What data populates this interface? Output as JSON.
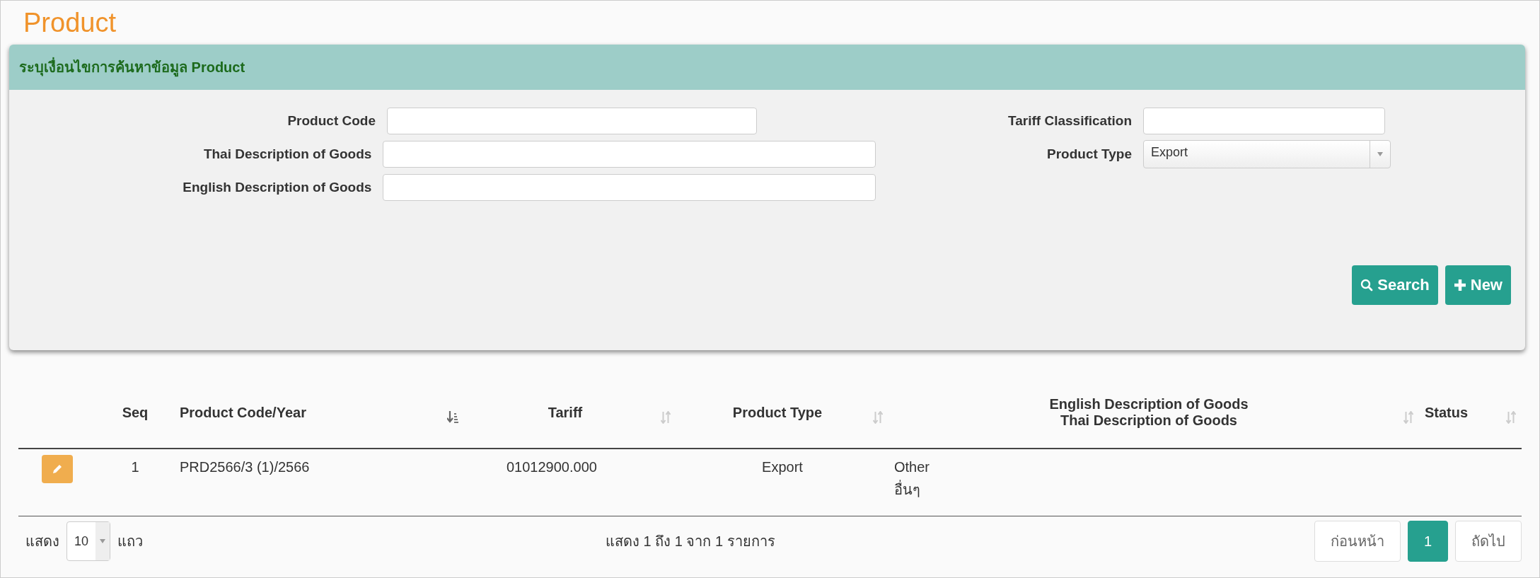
{
  "page_title": "Product",
  "search_panel": {
    "title": "ระบุเงื่อนไขการค้นหาข้อมูล Product",
    "left_fields": [
      {
        "label": "Product Code",
        "kind": "short"
      },
      {
        "label": "Thai Description of Goods",
        "kind": "long"
      },
      {
        "label": "English Description of Goods",
        "kind": "long"
      }
    ],
    "right_fields": [
      {
        "label": "Tariff Classification",
        "kind": "text"
      },
      {
        "label": "Product Type",
        "kind": "select",
        "value": "Export"
      }
    ],
    "buttons": [
      {
        "label": "Search",
        "kind": "search"
      },
      {
        "label": "New",
        "kind": "new"
      }
    ]
  },
  "table": {
    "columns": [
      {
        "label": "Seq",
        "kind": "plain"
      },
      {
        "label": "Product Code/Year",
        "kind": "sortable",
        "sorted": true
      },
      {
        "label": "Tariff",
        "kind": "sortable",
        "sorted": false
      },
      {
        "label": "Product Type",
        "kind": "sortable",
        "sorted": false
      },
      {
        "label": "English Description of Goods",
        "label_2": "Thai Description of Goods",
        "kind": "sortable",
        "sorted": false
      },
      {
        "label": "Status",
        "kind": "sortable",
        "sorted": false
      }
    ],
    "rows": [
      {
        "seq": "1",
        "product_code_year": "PRD2566/3 (1)/2566",
        "tariff": "01012900.000",
        "product_type": "Export",
        "english_description": "Other",
        "thai_description": "อื่นๆ"
      }
    ]
  },
  "footer": {
    "show_label": "แสดง",
    "page_size": "10",
    "rows_label": "แถว",
    "summary": "แสดง 1 ถึง 1 จาก 1 รายการ",
    "pager": [
      {
        "label": "ก่อนหน้า",
        "selected": false
      },
      {
        "label": "1",
        "selected": true
      },
      {
        "label": "ถัดไป",
        "selected": false
      }
    ]
  }
}
